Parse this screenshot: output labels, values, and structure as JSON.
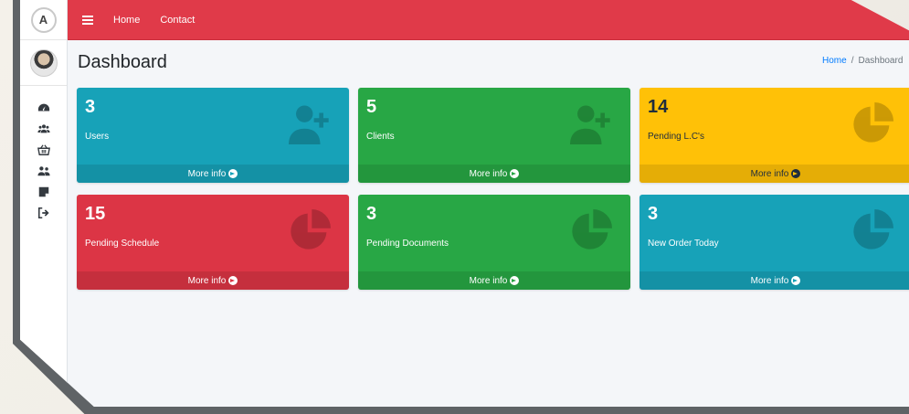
{
  "brand": {
    "logo_text": "A"
  },
  "topbar": {
    "links": [
      "Home",
      "Contact"
    ],
    "color": "#e03a49"
  },
  "sidebar": {
    "items": [
      {
        "icon": "dashboard-gauge-icon"
      },
      {
        "icon": "users-icon"
      },
      {
        "icon": "basket-icon"
      },
      {
        "icon": "user-group-icon"
      },
      {
        "icon": "note-icon"
      },
      {
        "icon": "sign-out-icon"
      }
    ]
  },
  "header": {
    "title": "Dashboard",
    "breadcrumb": {
      "home": "Home",
      "separator": "/",
      "current": "Dashboard"
    }
  },
  "boxes": [
    {
      "value": "3",
      "label": "Users",
      "footer": "More info",
      "color": "#17a2b8",
      "icon": "user-plus-icon"
    },
    {
      "value": "5",
      "label": "Clients",
      "footer": "More info",
      "color": "#28a745",
      "icon": "user-plus-icon"
    },
    {
      "value": "14",
      "label": "Pending L.C's",
      "footer": "More info",
      "color": "#ffc107",
      "icon": "pie-chart-icon"
    },
    {
      "value": "15",
      "label": "Pending Schedule",
      "footer": "More info",
      "color": "#dc3545",
      "icon": "pie-chart-icon"
    },
    {
      "value": "3",
      "label": "Pending Documents",
      "footer": "More info",
      "color": "#28a745",
      "icon": "pie-chart-icon"
    },
    {
      "value": "3",
      "label": "New Order Today",
      "footer": "More info",
      "color": "#17a2b8",
      "icon": "pie-chart-icon"
    }
  ]
}
